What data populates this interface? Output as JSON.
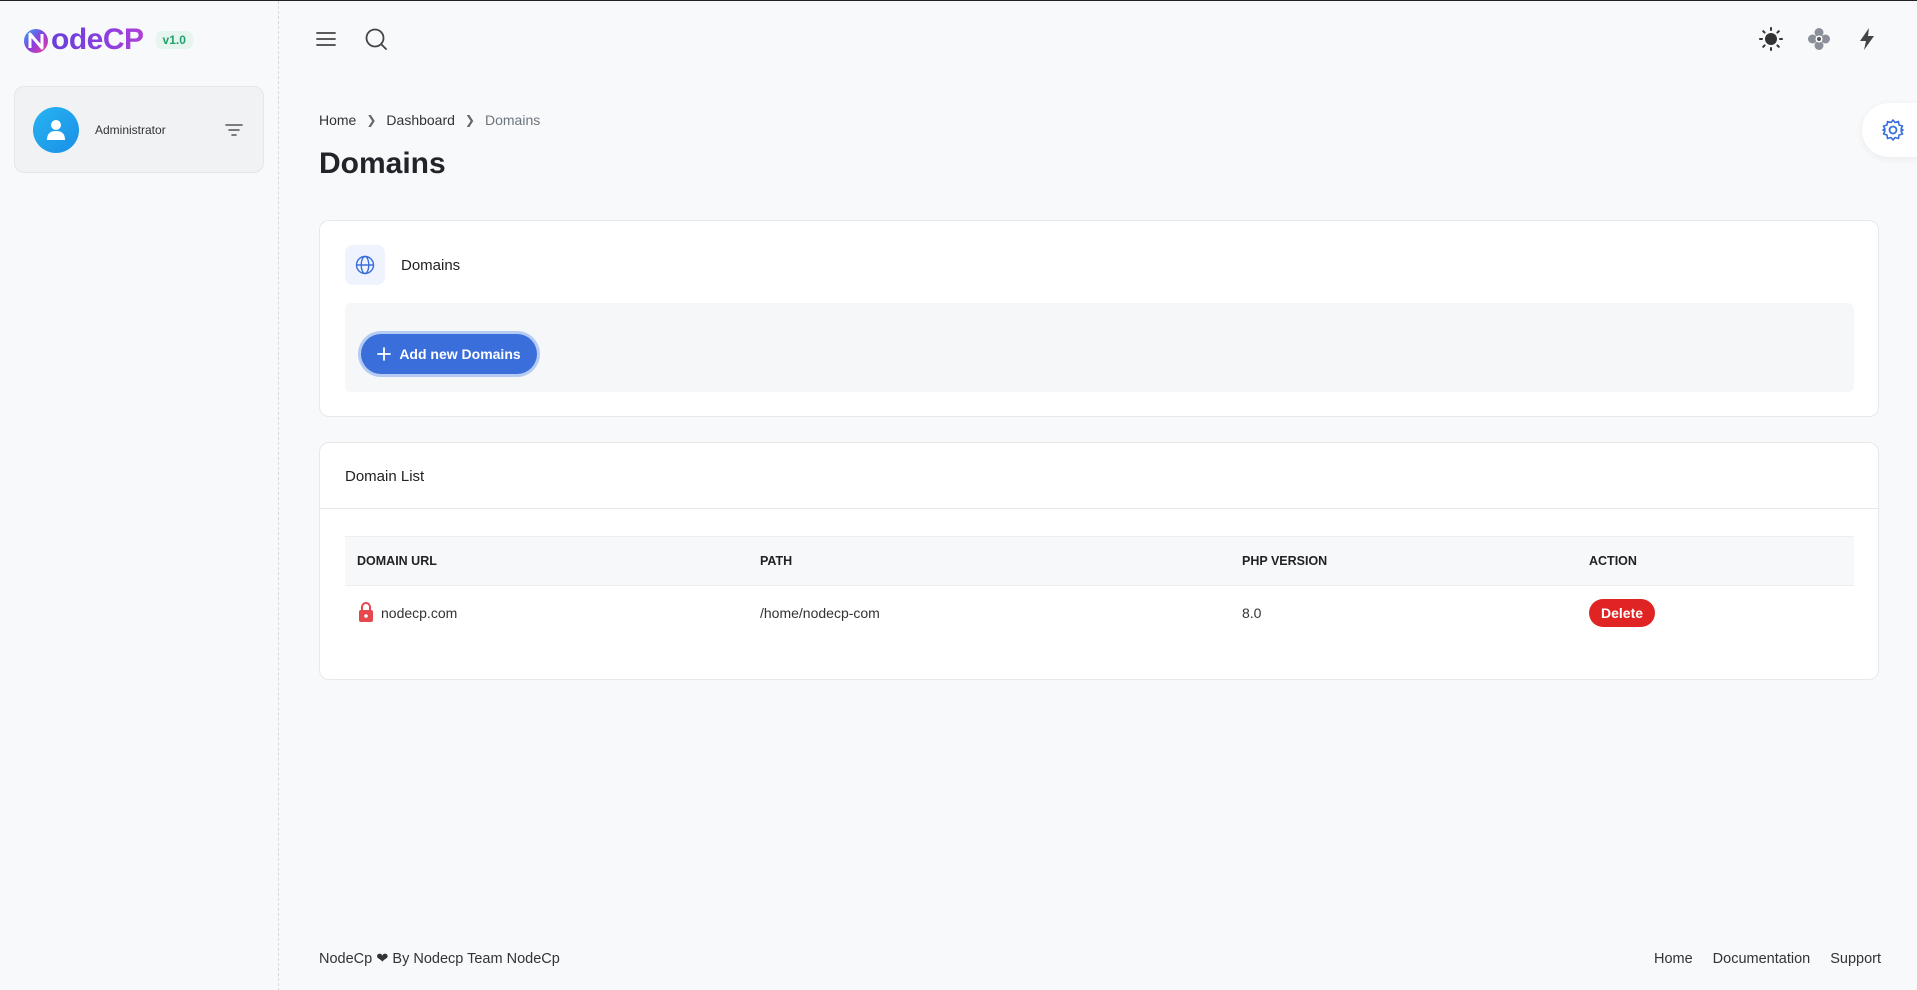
{
  "app": {
    "logo_text": "odeCP",
    "version": "v1.0"
  },
  "user": {
    "name": "Administrator"
  },
  "breadcrumb": [
    "Home",
    "Dashboard",
    "Domains"
  ],
  "page_title": "Domains",
  "domains_card": {
    "title": "Domains",
    "add_button_label": "Add new Domains"
  },
  "list_card": {
    "title": "Domain List",
    "columns": [
      "DOMAIN URL",
      "PATH",
      "PHP VERSION",
      "ACTION"
    ],
    "rows": [
      {
        "domain": "nodecp.com",
        "path": "/home/nodecp-com",
        "php": "8.0",
        "action": "Delete"
      }
    ]
  },
  "footer": {
    "brand": "NodeCp",
    "heart": "❤",
    "credit": "By Nodecp Team NodeCp",
    "links": [
      "Home",
      "Documentation",
      "Support"
    ]
  },
  "colors": {
    "primary": "#3a6edb",
    "danger": "#e02424",
    "badge_green": "#22a06b",
    "logo_purple": "#7b3fe0"
  },
  "icons": [
    "menu-icon",
    "search-icon",
    "sun-icon",
    "flower-icon",
    "bolt-icon",
    "gear-icon",
    "globe-icon",
    "plus-icon",
    "lock-icon",
    "user-icon",
    "filter-icon"
  ]
}
